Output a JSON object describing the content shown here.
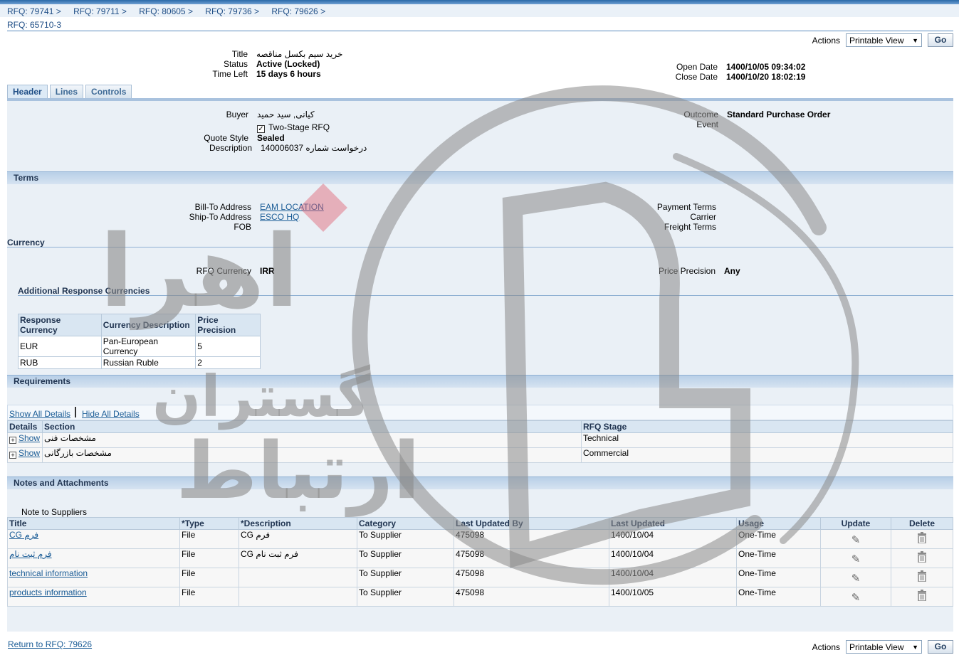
{
  "breadcrumbs": [
    "RFQ: 79741",
    "RFQ: 79711",
    "RFQ: 80605",
    "RFQ: 79736",
    "RFQ: 79626"
  ],
  "page_title": "RFQ: 65710-3",
  "actions": {
    "label": "Actions",
    "selected": "Printable View",
    "go": "Go"
  },
  "summary": {
    "title_label": "Title",
    "title_value": "خرید سیم بکسل مناقصه",
    "status_label": "Status",
    "status_value": "Active (Locked)",
    "time_left_label": "Time Left",
    "time_left_value": "15 days 6 hours",
    "open_date_label": "Open Date",
    "open_date_value": "1400/10/05 09:34:02",
    "close_date_label": "Close Date",
    "close_date_value": "1400/10/20 18:02:19"
  },
  "tabs": [
    "Header",
    "Lines",
    "Controls"
  ],
  "header": {
    "buyer_label": "Buyer",
    "buyer_value": "کیانی, سید حمید",
    "two_stage_label": "Two-Stage RFQ",
    "quote_style_label": "Quote Style",
    "quote_style_value": "Sealed",
    "description_label": "Description",
    "description_value": "درخواست شماره 140006037",
    "outcome_label": "Outcome",
    "outcome_value": "Standard Purchase Order",
    "event_label": "Event"
  },
  "terms": {
    "title": "Terms",
    "bill_to_label": "Bill-To Address",
    "bill_to_value": "EAM LOCATION",
    "ship_to_label": "Ship-To Address",
    "ship_to_value": "ESCO HQ",
    "fob_label": "FOB",
    "payment_terms_label": "Payment Terms",
    "carrier_label": "Carrier",
    "freight_terms_label": "Freight Terms"
  },
  "currency": {
    "title": "Currency",
    "rfq_currency_label": "RFQ Currency",
    "rfq_currency_value": "IRR",
    "price_precision_label": "Price Precision",
    "price_precision_value": "Any",
    "additional_title": "Additional Response Currencies",
    "columns": [
      "Response Currency",
      "Currency Description",
      "Price Precision"
    ],
    "rows": [
      [
        "EUR",
        "Pan-European Currency",
        "5"
      ],
      [
        "RUB",
        "Russian Ruble",
        "2"
      ]
    ]
  },
  "requirements": {
    "title": "Requirements",
    "show_all": "Show All Details",
    "hide_all": "Hide All Details",
    "columns": [
      "Details",
      "Section",
      "RFQ Stage"
    ],
    "rows": [
      {
        "show": "Show",
        "section": "مشخصات فنی",
        "stage": "Technical"
      },
      {
        "show": "Show",
        "section": "مشخصات بازرگانی",
        "stage": "Commercial"
      }
    ]
  },
  "notes": {
    "title": "Notes and Attachments",
    "note_label": "Note to Suppliers",
    "columns": [
      "Title",
      "*Type",
      "*Description",
      "Category",
      "Last Updated By",
      "Last Updated",
      "Usage",
      "Update",
      "Delete"
    ],
    "rows": [
      [
        "فرم CG",
        "File",
        "فرم CG",
        "To Supplier",
        "475098",
        "1400/10/04",
        "One-Time"
      ],
      [
        "فرم ثبت نام",
        "File",
        "فرم ثبت نام CG",
        "To Supplier",
        "475098",
        "1400/10/04",
        "One-Time"
      ],
      [
        "technical information",
        "File",
        "",
        "To Supplier",
        "475098",
        "1400/10/04",
        "One-Time"
      ],
      [
        "products information",
        "File",
        "",
        "To Supplier",
        "475098",
        "1400/10/05",
        "One-Time"
      ]
    ]
  },
  "return_link": "Return to RFQ: 79626",
  "watermark_text": [
    "اهرا",
    "گستران",
    "ارتباط"
  ],
  "colors": {
    "link": "#1a5c96",
    "section_header": "#b8cfe7",
    "panel": "#eaf0f6",
    "watermark": "#8a8a8a"
  }
}
